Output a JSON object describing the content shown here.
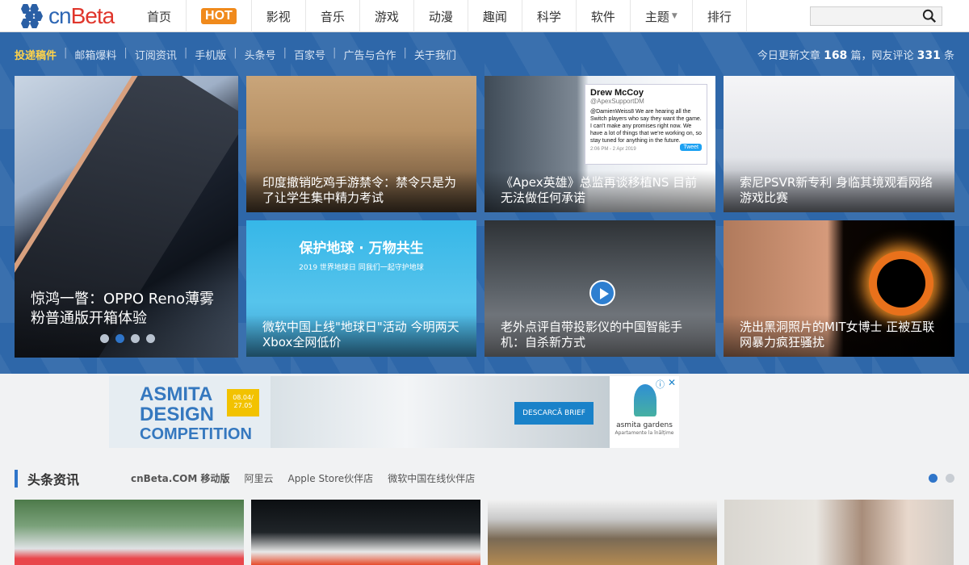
{
  "logo": {
    "text_main": "cn",
    "text_accent": "Beta"
  },
  "nav": {
    "items": [
      "首页",
      "HOT",
      "影视",
      "音乐",
      "游戏",
      "动漫",
      "趣闻",
      "科学",
      "软件",
      "主题",
      "排行"
    ]
  },
  "search": {
    "placeholder": "",
    "icon": "search-icon"
  },
  "subnav": {
    "items": [
      "投递稿件",
      "邮箱爆料",
      "订阅资讯",
      "手机版",
      "头条号",
      "百家号",
      "广告与合作",
      "关于我们"
    ]
  },
  "stats": {
    "prefix": "今日更新文章",
    "articles": "168",
    "mid": "篇，网友评论",
    "comments": "331",
    "suffix": "条"
  },
  "slider": {
    "caption": "惊鸿一瞥：OPPO Reno薄雾粉普通版开箱体验",
    "dots": 4,
    "active": 1
  },
  "cards": [
    {
      "caption": "印度撤销吃鸡手游禁令：禁令只是为了让学生集中精力考试"
    },
    {
      "caption": "《Apex英雄》总监再谈移植NS 目前无法做任何承诺",
      "tweet_name": "Drew McCoy",
      "tweet_handle": "@ApexSupportDM",
      "tweet_text": "@DamienWeiss8 We are hearing all the Switch players who say they want the game. I can't make any promises right now. We have a lot of things that we're working on, so stay tuned for anything in the future.",
      "tweet_time": "2:06 PM - 2 Apr 2019",
      "tweet_button": "Tweet"
    },
    {
      "caption": "索尼PSVR新专利 身临其境观看网络游戏比赛"
    },
    {
      "caption": "微软中国上线\"地球日\"活动 今明两天Xbox全网低价",
      "poster_title": "保护地球 · 万物共生",
      "poster_sub": "2019 世界地球日 同我们一起守护地球"
    },
    {
      "caption": "老外点评自带投影仪的中国智能手机：自杀新方式"
    },
    {
      "caption": "洗出黑洞照片的MIT女博士 正被互联网暴力疯狂骚扰"
    }
  ],
  "ad": {
    "title_line1": "ASMITA",
    "title_line2": "DESIGN",
    "title_line3": "COMPETITION",
    "date": "08.04/ 27.05",
    "button": "DESCARCĂ BRIEF",
    "brand": "asmita gardens",
    "brand_sub": "Apartamente la înălțime",
    "info_icon": "ⓘ",
    "close_icon": "✕"
  },
  "section": {
    "title": "头条资讯",
    "links": [
      "cnBeta.COM 移动版",
      "阿里云",
      "Apple Store伙伴店",
      "微软中国在线伙伴店"
    ],
    "dots": 2,
    "active": 0
  },
  "colors": {
    "brand_blue": "#2e67a9",
    "accent_orange": "#f08a1c",
    "highlight_yellow": "#ffd34a"
  }
}
